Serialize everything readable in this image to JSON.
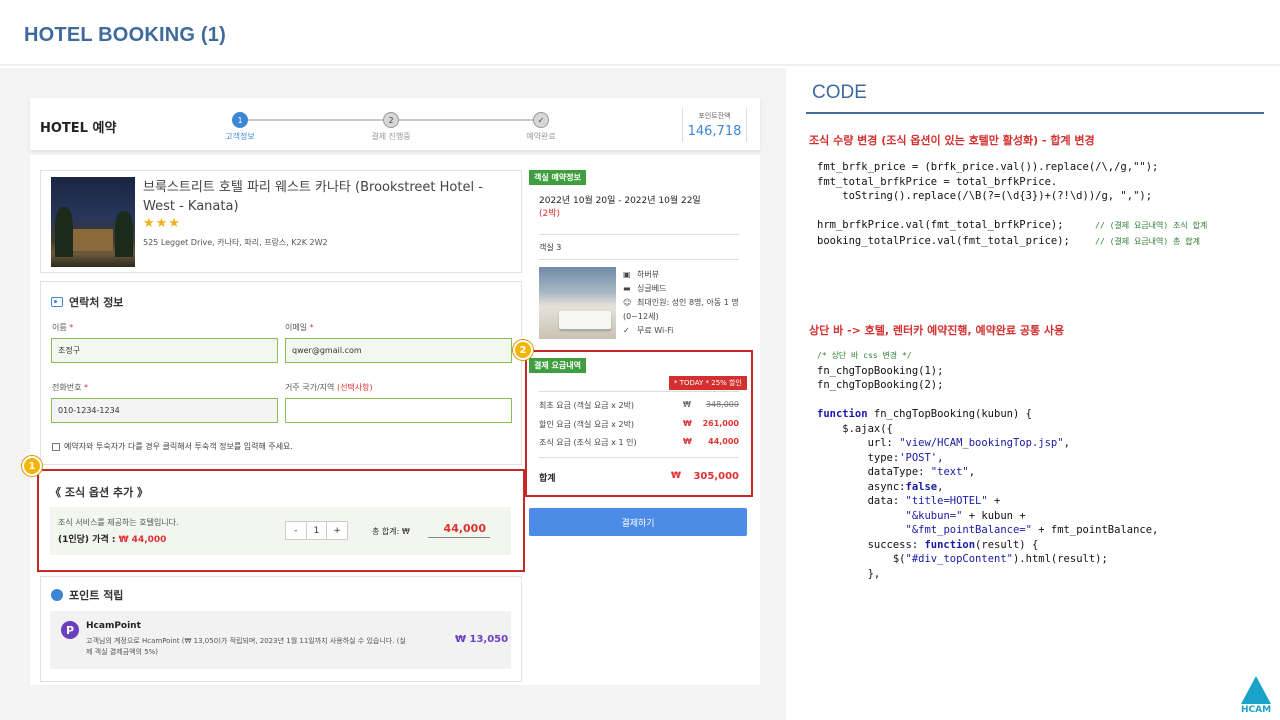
{
  "slide_title": "HOTEL BOOKING (1)",
  "booking": {
    "brand": "HOTEL 예약",
    "steps": [
      {
        "num": "1",
        "label": "고객정보"
      },
      {
        "num": "2",
        "label": "결제 진행중"
      },
      {
        "num": "✓",
        "label": "예약완료"
      }
    ],
    "points_label": "포인트잔액",
    "points_value": "146,718",
    "hotel_name": "브룩스트리트 호텔 파리 웨스트 카나타 (Brookstreet Hotel - West - Kanata)",
    "stars": "★★★",
    "hotel_address": "525 Legget Drive, 카나타, 파리, 프랑스, K2K 2W2",
    "contact": {
      "title": "연락처 정보",
      "name_label": "이름",
      "name_value": "조정구",
      "email_label": "이메일",
      "email_value": "qwer@gmail.com",
      "phone_label": "전화번호",
      "phone_value": "010-1234-1234",
      "country_label": "거주 국가/지역",
      "country_optional": "(선택사항)",
      "country_value": "",
      "required_mark": "*",
      "checkbox_text": "예약자와 투숙자가 다를 경우 클릭해서 투숙객 정보를 입력해 주세요."
    },
    "breakfast": {
      "title": "《 조식 옵션 추가 》",
      "desc": "조식 서비스를 제공하는 호텔입니다.",
      "price_label": "(1인당) 가격 :",
      "price_value": "₩ 44,000",
      "minus": "-",
      "qty": "1",
      "plus": "+",
      "total_label": "총 합계:  ₩",
      "total_value": "44,000"
    },
    "points": {
      "title": "포인트 적립",
      "logo": "P",
      "name": "HcamPoint",
      "desc": "고객님의 계정으로 HcamPoint (₩ 13,050)가 적립되며, 2023년 1월 11일까지 사용하실 수 있습니다. (실제 객실 결제금액의 5%)",
      "value": "₩ 13,050"
    },
    "room_info": {
      "tag": "객실 예약정보",
      "dates": "2022년 10월 20일 - 2022년 10월 22일",
      "nights": "(2박)",
      "room": "객실 3",
      "features": [
        "하버뷰",
        "싱글베드",
        "최대인원: 성인 8명, 아동 1 명 (0~12세)",
        "무료 Wi-Fi"
      ]
    },
    "fees": {
      "tag": "결제 요금내역",
      "today_badge": "* TODAY * 25% 할인",
      "rows": [
        {
          "label": "최초 요금 (객실 요금 x 2박)",
          "won": "₩",
          "value": "348,000"
        },
        {
          "label": "할인 요금 (객실 요금 x 2박)",
          "won": "₩",
          "value": "261,000"
        },
        {
          "label": "조식 요금 (조식 요금 x 1 인)",
          "won": "₩",
          "value": "44,000"
        }
      ],
      "total_label": "합계",
      "total_won": "₩",
      "total_value": "305,000",
      "pay_button": "결제하기"
    },
    "badges": [
      "1",
      "2"
    ]
  },
  "code_panel": {
    "title": "CODE",
    "head1": "조식 수량 변경 (조식 옵션이 있는 호텔만 활성화) - 합계 변경",
    "head2": "상단 바 -> 호텔, 렌터카 예약진행, 예약완료 공통 사용"
  },
  "logo_text": "HCAM",
  "colors": {
    "accent": "#3d6b9e",
    "highlight": "#c62828",
    "green": "#3f9e3f",
    "button": "#4d8ce6"
  }
}
